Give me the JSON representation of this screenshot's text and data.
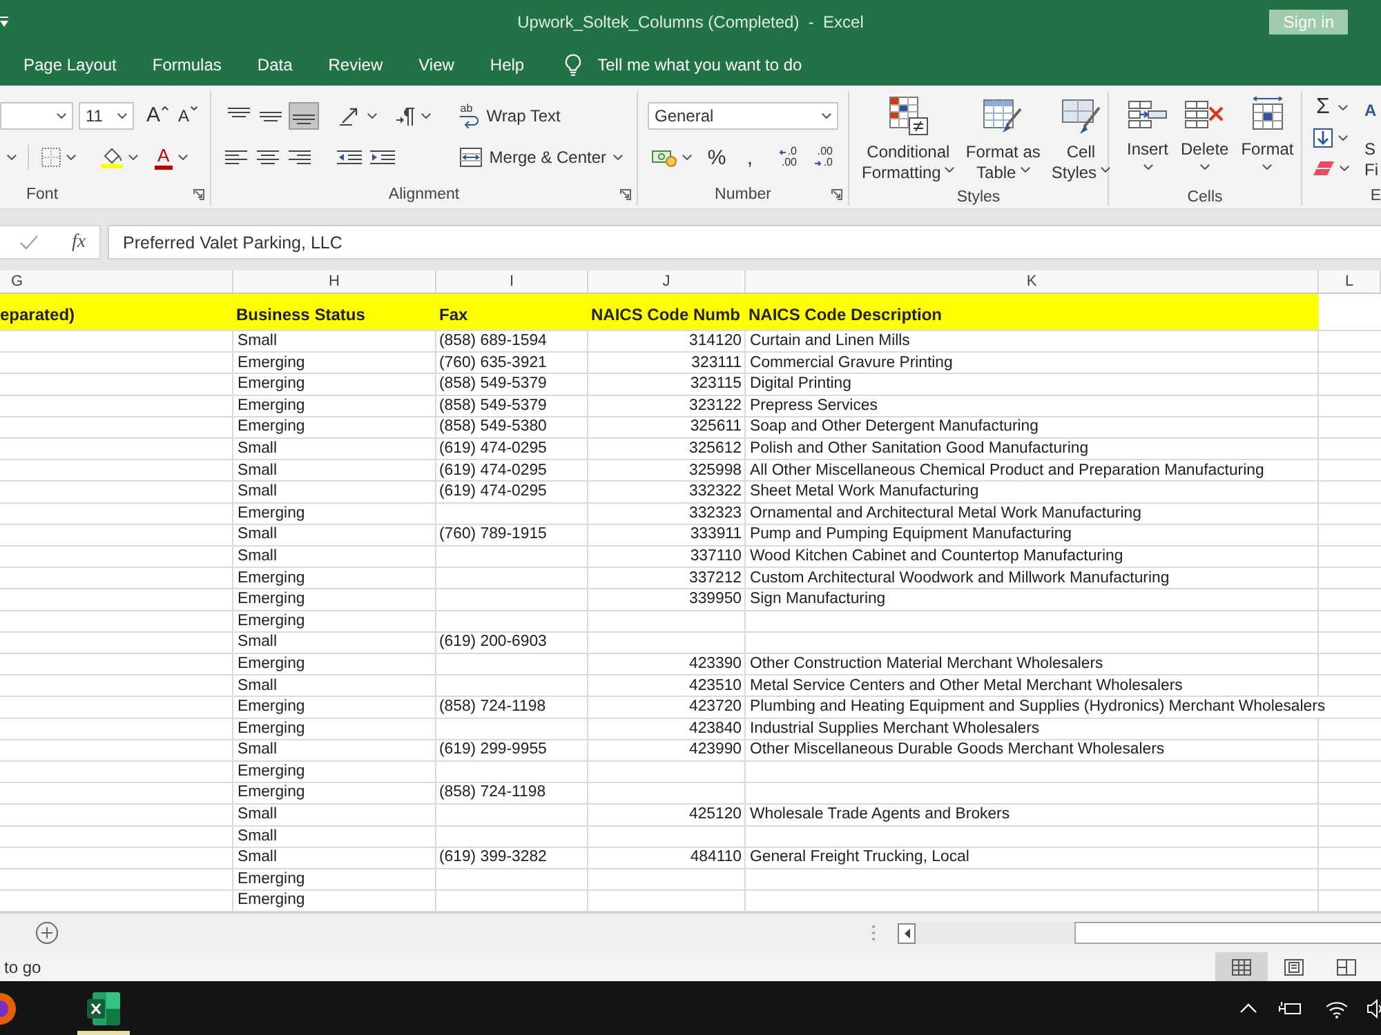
{
  "window": {
    "title": "Upwork_Soltek_Columns (Completed)  -  Excel",
    "sign_in": "Sign in"
  },
  "menu": {
    "tabs": [
      {
        "label": "Page Layout",
        "selected": false
      },
      {
        "label": "Formulas",
        "selected": false
      },
      {
        "label": "Data",
        "selected": false
      },
      {
        "label": "Review",
        "selected": false
      },
      {
        "label": "View",
        "selected": false
      },
      {
        "label": "Help",
        "selected": false
      }
    ],
    "tell_me": {
      "placeholder": "Tell me what you want to do"
    }
  },
  "ribbon": [
    {
      "kind": "font",
      "label": "Font",
      "font_size": "11",
      "grow": "A",
      "shrink": "A",
      "font_color": "A"
    },
    {
      "kind": "alignment",
      "label": "Alignment",
      "vertical": [
        {
          "kind": "top",
          "selected": false
        },
        {
          "kind": "middle",
          "selected": false
        },
        {
          "kind": "bottom",
          "selected": true
        }
      ],
      "wrap_icon": "ab",
      "wrap": "Wrap Text",
      "merge": "Merge & Center"
    },
    {
      "kind": "number",
      "label": "Number",
      "format": "General",
      "percent": "%",
      "comma": ",",
      "increase_decimal": [
        ".0",
        ".00"
      ],
      "decrease_decimal": [
        ".00",
        ".0"
      ]
    },
    {
      "kind": "styles",
      "label": "Styles",
      "buttons": [
        {
          "kind": "conditional",
          "lines": [
            "Conditional",
            "Formatting"
          ]
        },
        {
          "kind": "table",
          "lines": [
            "Format as",
            "Table"
          ]
        },
        {
          "kind": "cell",
          "lines": [
            "Cell",
            "Styles"
          ]
        }
      ]
    },
    {
      "kind": "cells",
      "label": "Cells",
      "buttons": [
        {
          "kind": "insert",
          "text": "Insert"
        },
        {
          "kind": "delete",
          "text": "Delete"
        },
        {
          "kind": "format",
          "text": "Format"
        }
      ]
    },
    {
      "kind": "editing",
      "label": "E",
      "sum": "Σ",
      "sort_icon": "A",
      "sort_lines": [
        "S",
        "Fi"
      ]
    }
  ],
  "formula_bar": {
    "fx": "fx",
    "value": "Preferred Valet Parking, LLC"
  },
  "sheet": {
    "columns": [
      "G",
      "H",
      "I",
      "J",
      "K",
      "L"
    ],
    "header": [
      "eparated)",
      "Business Status",
      "Fax",
      "NAICS Code Numb",
      "NAICS Code Description"
    ],
    "rows": [
      {
        "status": "Small",
        "fax": "(858) 689-1594",
        "code": "314120",
        "description": "Curtain and Linen Mills"
      },
      {
        "status": "Emerging",
        "fax": "(760) 635-3921",
        "code": "323111",
        "description": "Commercial Gravure Printing"
      },
      {
        "status": "Emerging",
        "fax": "(858) 549-5379",
        "code": "323115",
        "description": "Digital Printing"
      },
      {
        "status": "Emerging",
        "fax": "(858) 549-5379",
        "code": "323122",
        "description": "Prepress Services"
      },
      {
        "status": "Emerging",
        "fax": "(858) 549-5380",
        "code": "325611",
        "description": "Soap and Other Detergent Manufacturing"
      },
      {
        "status": "Small",
        "fax": "(619) 474-0295",
        "code": "325612",
        "description": "Polish and Other Sanitation Good Manufacturing"
      },
      {
        "status": "Small",
        "fax": "(619) 474-0295",
        "code": "325998",
        "description": "All Other Miscellaneous Chemical Product and Preparation Manufacturing"
      },
      {
        "status": "Small",
        "fax": "(619) 474-0295",
        "code": "332322",
        "description": "Sheet Metal Work Manufacturing"
      },
      {
        "status": "Emerging",
        "code": "332323",
        "description": "Ornamental and Architectural Metal Work Manufacturing"
      },
      {
        "status": "Small",
        "fax": "(760) 789-1915",
        "code": "333911",
        "description": "Pump and Pumping Equipment Manufacturing"
      },
      {
        "status": "Small",
        "code": "337110",
        "description": "Wood Kitchen Cabinet and Countertop Manufacturing"
      },
      {
        "status": "Emerging",
        "code": "337212",
        "description": "Custom Architectural Woodwork and Millwork Manufacturing"
      },
      {
        "status": "Emerging",
        "code": "339950",
        "description": "Sign Manufacturing"
      },
      {
        "status": "Emerging"
      },
      {
        "status": "Small",
        "fax": "(619) 200-6903"
      },
      {
        "status": "Emerging",
        "code": "423390",
        "description": "Other Construction Material Merchant Wholesalers"
      },
      {
        "status": "Small",
        "code": "423510",
        "description": "Metal Service Centers and Other Metal Merchant Wholesalers"
      },
      {
        "status": "Emerging",
        "fax": "(858) 724-1198",
        "code": "423720",
        "description": "Plumbing and Heating Equipment and Supplies (Hydronics) Merchant Wholesalers"
      },
      {
        "status": "Emerging",
        "code": "423840",
        "description": "Industrial Supplies Merchant Wholesalers"
      },
      {
        "status": "Small",
        "fax": "(619) 299-9955",
        "code": "423990",
        "description": "Other Miscellaneous Durable Goods Merchant Wholesalers"
      },
      {
        "status": "Emerging"
      },
      {
        "status": "Emerging",
        "fax": "(858) 724-1198"
      },
      {
        "status": "Small",
        "code": "425120",
        "description": "Wholesale Trade Agents and Brokers"
      },
      {
        "status": "Small"
      },
      {
        "status": "Small",
        "fax": "(619) 399-3282",
        "code": "484110",
        "description": "General Freight Trucking, Local"
      },
      {
        "status": "Emerging"
      },
      {
        "status": "Emerging"
      }
    ]
  },
  "status_bar": {
    "text": "to go",
    "views": [
      {
        "kind": "normal",
        "selected": true
      },
      {
        "kind": "page_layout",
        "selected": false
      },
      {
        "kind": "page_break",
        "selected": false
      }
    ]
  },
  "taskbar": {
    "apps": [
      {
        "kind": "browser",
        "selected": false
      },
      {
        "kind": "spreadsheet",
        "selected": true
      }
    ]
  }
}
